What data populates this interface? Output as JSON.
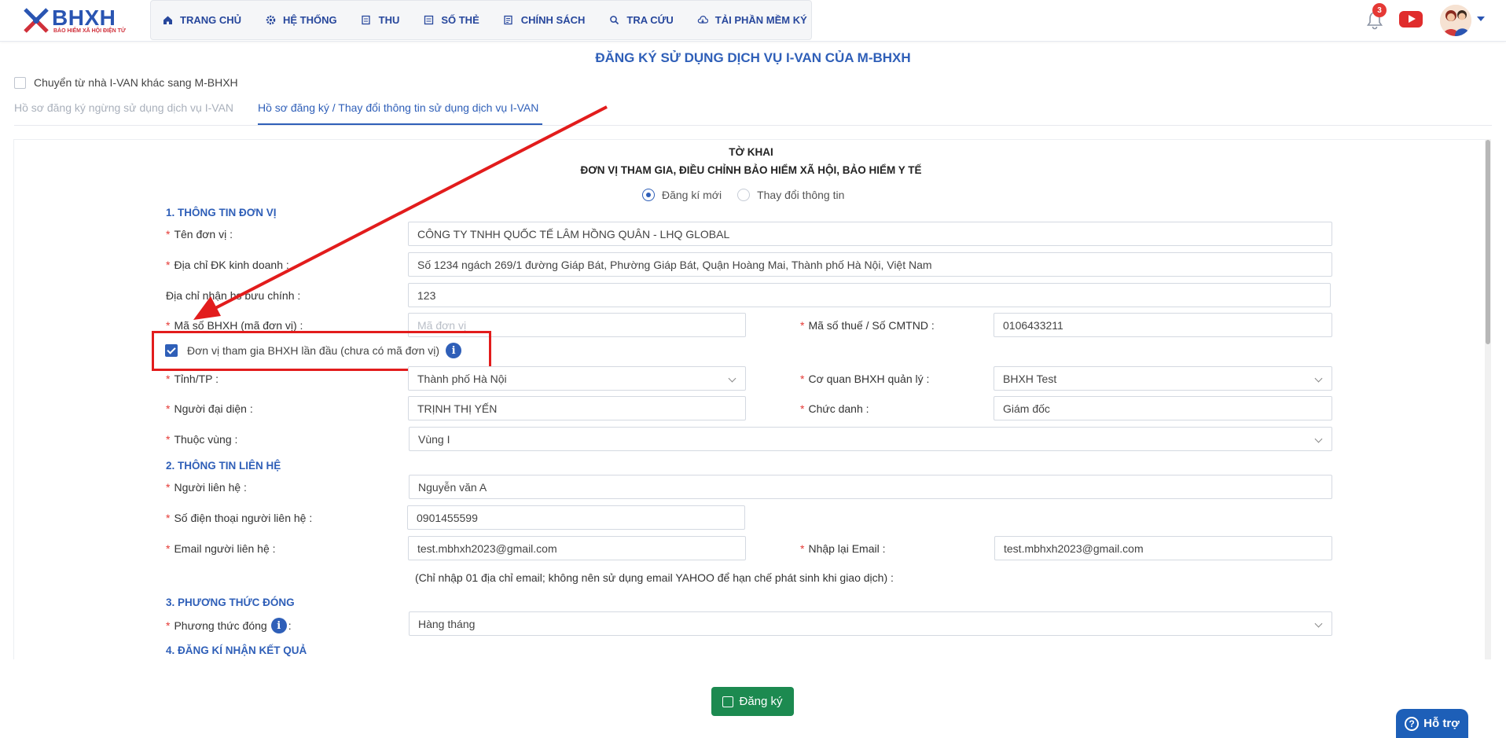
{
  "header": {
    "logo_text": "BHXH",
    "logo_sub": "BẢO HIỂM XÃ HỘI ĐIỆN TỬ",
    "nav": [
      {
        "label": "TRANG CHỦ",
        "icon": "home-icon"
      },
      {
        "label": "HỆ THỐNG",
        "icon": "gear-icon"
      },
      {
        "label": "THU",
        "icon": "doc-icon"
      },
      {
        "label": "SỐ THẺ",
        "icon": "card-icon"
      },
      {
        "label": "CHÍNH SÁCH",
        "icon": "policy-icon"
      },
      {
        "label": "TRA CỨU",
        "icon": "search-icon"
      },
      {
        "label": "TẢI PHẦN MỀM KÝ",
        "icon": "cloud-download-icon"
      }
    ],
    "notification_count": "3"
  },
  "page": {
    "title": "ĐĂNG KÝ SỬ DỤNG DỊCH VỤ I-VAN CỦA M-BHXH",
    "transfer_checkbox_label": "Chuyển từ nhà I-VAN khác sang M-BHXH",
    "tabs": [
      {
        "label": "Hồ sơ đăng ký ngừng sử dụng dịch vụ I-VAN",
        "active": false
      },
      {
        "label": "Hồ sơ đăng ký / Thay đổi thông tin sử dụng dịch vụ I-VAN",
        "active": true
      }
    ]
  },
  "form": {
    "heading1": "TỜ KHAI",
    "heading2": "ĐƠN VỊ THAM GIA, ĐIỀU CHỈNH BẢO HIỂM XÃ HỘI, BẢO HIỂM Y TẾ",
    "radio_new": "Đăng kí mới",
    "radio_change": "Thay đổi thông tin",
    "section1": "1. THÔNG TIN ĐƠN VỊ",
    "section2": "2. THÔNG TIN LIÊN HỆ",
    "section3": "3. PHƯƠNG THỨC ĐÓNG",
    "section4": "4. ĐĂNG KÍ NHẬN KẾT QUẢ",
    "req_mark": "*",
    "fields": {
      "ten_don_vi": {
        "label": "Tên đơn vị :",
        "value": "CÔNG TY TNHH QUỐC TẾ LÂM HỒNG QUÂN - LHQ GLOBAL"
      },
      "dia_chi_dk": {
        "label": "Địa chỉ ĐK kinh doanh :",
        "value": "Số 1234 ngách 269/1 đường Giáp Bát, Phường Giáp Bát, Quận Hoàng Mai, Thành phố Hà Nội, Việt Nam"
      },
      "dia_chi_nhan": {
        "label": "Địa chỉ nhận hs bưu chính :",
        "value": "123"
      },
      "ma_so_bhxh": {
        "label": "Mã số BHXH (mã đơn vị) :",
        "placeholder": "Mã đơn vị"
      },
      "ma_so_thue": {
        "label": "Mã số thuế / Số CMTND :",
        "value": "0106433211"
      },
      "first_time": {
        "label": "Đơn vị tham gia BHXH lần đầu (chưa có mã đơn vị)",
        "info": "i"
      },
      "tinh_tp": {
        "label": "Tỉnh/TP :",
        "value": "Thành phố Hà Nội"
      },
      "co_quan": {
        "label": "Cơ quan BHXH quản lý :",
        "value": "BHXH Test"
      },
      "nguoi_dai_dien": {
        "label": "Người đại diện :",
        "value": "TRỊNH THỊ YẾN"
      },
      "chuc_danh": {
        "label": "Chức danh :",
        "value": "Giám đốc"
      },
      "thuoc_vung": {
        "label": "Thuộc vùng :",
        "value": "Vùng I"
      },
      "nguoi_lien_he": {
        "label": "Người liên hệ :",
        "value": "Nguyễn văn A"
      },
      "sdt": {
        "label": "Số điện thoại người liên hệ :",
        "value": "0901455599"
      },
      "email": {
        "label": "Email người liên hệ :",
        "value": "test.mbhxh2023@gmail.com"
      },
      "nhap_lai_email": {
        "label": "Nhập lại Email :",
        "value": "test.mbhxh2023@gmail.com"
      },
      "email_note": "(Chỉ nhập 01 địa chỉ email; không nên sử dụng email YAHOO để hạn chế phát sinh khi giao dịch) :",
      "phuong_thuc": {
        "label": "Phương thức đóng",
        "colon": ":",
        "value": "Hàng tháng"
      }
    }
  },
  "actions": {
    "submit_label": "Đăng ký",
    "help_label": "Hỗ trợ",
    "help_icon": "?"
  },
  "colors": {
    "primary": "#2f5fb8",
    "annotation": "#e21c1c",
    "submit": "#1c8a50"
  }
}
